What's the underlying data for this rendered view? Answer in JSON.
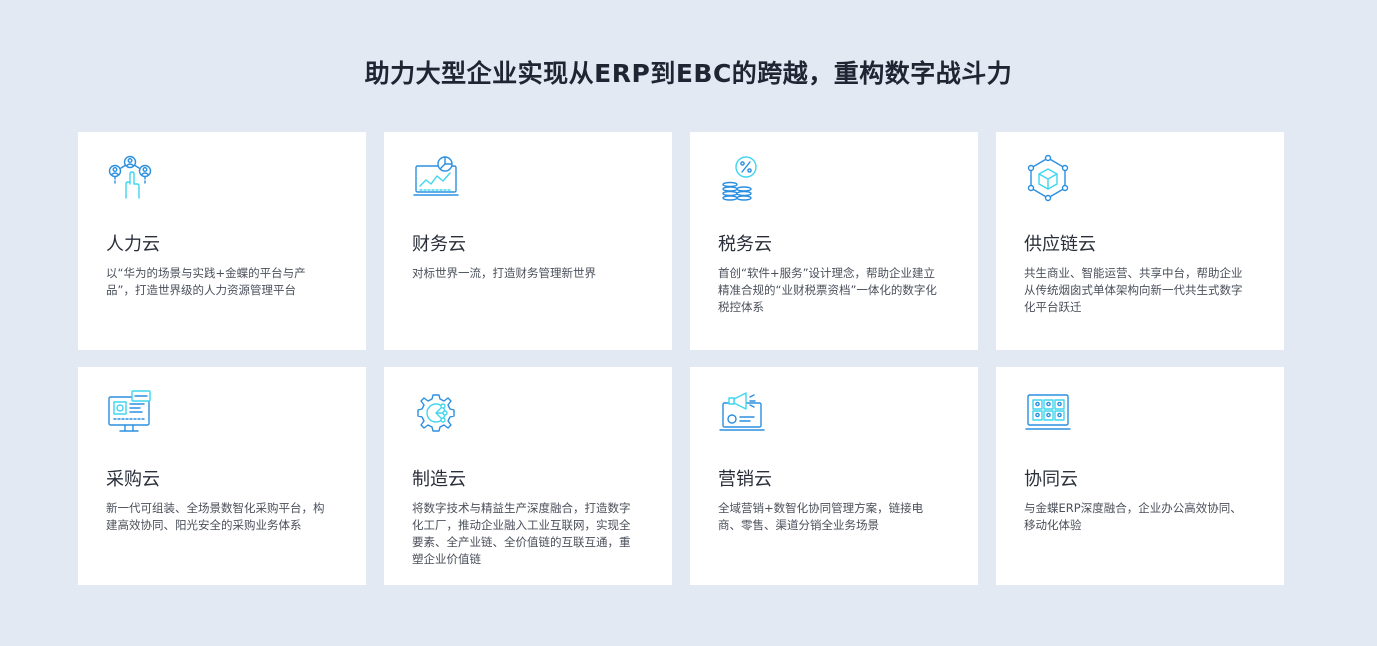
{
  "page": {
    "title": "助力大型企业实现从ERP到EBC的跨越，重构数字战斗力"
  },
  "colors": {
    "background": "#e2e9f2",
    "icon_primary": "#2b8fe0",
    "icon_accent": "#3fd6ee"
  },
  "cards": [
    {
      "icon": "people-network-icon",
      "title": "人力云",
      "desc": "以“华为的场景与实践+金蝶的平台与产品”，打造世界级的人力资源管理平台"
    },
    {
      "icon": "laptop-chart-icon",
      "title": "财务云",
      "desc": "对标世界一流，打造财务管理新世界"
    },
    {
      "icon": "coins-percent-icon",
      "title": "税务云",
      "desc": "首创“软件+服务”设计理念，帮助企业建立精准合规的“业财税票资档”一体化的数字化税控体系"
    },
    {
      "icon": "network-cube-icon",
      "title": "供应链云",
      "desc": "共生商业、智能运营、共享中台，帮助企业从传统烟囱式单体架构向新一代共生式数字化平台跃迁"
    },
    {
      "icon": "monitor-dashboard-icon",
      "title": "采购云",
      "desc": "新一代可组装、全场景数智化采购平台，构建高效协同、阳光安全的采购业务体系"
    },
    {
      "icon": "gear-nodes-icon",
      "title": "制造云",
      "desc": "将数字技术与精益生产深度融合，打造数字化工厂，推动企业融入工业互联网，实现全要素、全产业链、全价值链的互联互通，重塑企业价值链"
    },
    {
      "icon": "laptop-megaphone-icon",
      "title": "营销云",
      "desc": "全域营销+数智化协同管理方案，链接电商、零售、渠道分销全业务场景"
    },
    {
      "icon": "video-meeting-icon",
      "title": "协同云",
      "desc": "与金蝶ERP深度融合，企业办公高效协同、移动化体验"
    }
  ]
}
